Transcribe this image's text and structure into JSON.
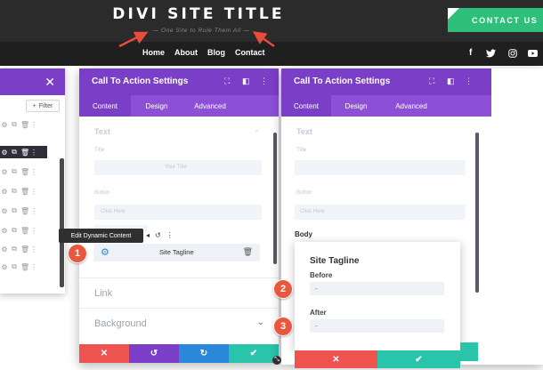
{
  "header": {
    "site_title": "DIVI SITE TITLE",
    "tagline": "— One Site to Rule Them All —",
    "contact_button": "CONTACT US",
    "nav": [
      "Home",
      "About",
      "Blog",
      "Contact"
    ],
    "social_icons": [
      "facebook-icon",
      "twitter-icon",
      "instagram-icon",
      "youtube-icon"
    ]
  },
  "layers_panel": {
    "close": "✕",
    "filter": "Filter"
  },
  "modal_left": {
    "title": "Call To Action Settings",
    "tabs": [
      "Content",
      "Design",
      "Advanced"
    ],
    "active_tab": "Content",
    "ghost_section": "Text",
    "ghost_title_label": "Title",
    "ghost_title_value": "Your Title",
    "ghost_button_label": "Button",
    "ghost_button_value": "Click Here",
    "tooltip": "Edit Dynamic Content",
    "dynamic_field": "Site Tagline",
    "toggles": [
      "Link",
      "Background"
    ]
  },
  "modal_right": {
    "title": "Call To Action Settings",
    "tabs": [
      "Content",
      "Design",
      "Advanced"
    ],
    "active_tab": "Content",
    "ghost_section": "Text",
    "body_label": "Body",
    "popover": {
      "title": "Site Tagline",
      "before_label": "Before",
      "before_value": "-",
      "after_label": "After",
      "after_value": "-"
    }
  },
  "badges": [
    "1",
    "2",
    "3"
  ],
  "colors": {
    "header_bg": "#2b2b2b",
    "nav_bg": "#1f1f1f",
    "modal_purple": "#7b3ec6",
    "tab_purple": "#8c4fd6",
    "contact_green": "#2ec07a",
    "cancel_red": "#ef5350",
    "undo_purple": "#7b3ec6",
    "redo_blue": "#2b87da",
    "save_green": "#29c4a9",
    "badge_orange": "#e9573f",
    "arrow_red": "#e74c3c"
  }
}
